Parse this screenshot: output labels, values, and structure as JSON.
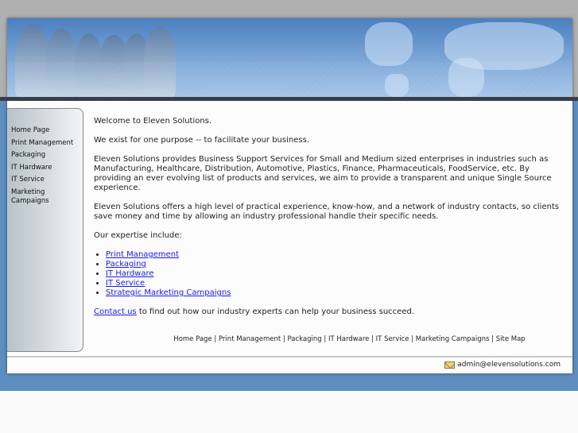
{
  "sidebar": {
    "items": [
      "Home Page",
      "Print Management",
      "Packaging",
      "IT Hardware",
      "IT Service",
      "Marketing Campaigns"
    ]
  },
  "main": {
    "welcome": "Welcome to Eleven Solutions.",
    "purpose": "We exist for one purpose -- to facilitate your business.",
    "para1": "Eleven Solutions provides Business Support Services for Small and Medium sized enterprises in industries such as Manufacturing, Healthcare, Distribution, Automotive, Plastics, Finance, Pharmaceuticals, FoodService, etc. By providing an ever evolving list of products and services, we aim to provide a transparent and unique Single Source experience.",
    "para2": "Eleven Solutions offers a high level of practical experience, know-how, and a network of industry contacts, so clients save money and time by allowing an industry professional handle their specific needs.",
    "expertise_intro": "Our expertise include:",
    "expertise": [
      "Print Management",
      "Packaging",
      "IT Hardware",
      "IT Service",
      "Strategic Marketing Campaigns"
    ],
    "contact_link": "Contact us",
    "contact_rest": " to find out how our industry experts can help your business succeed."
  },
  "footer_links": [
    "Home Page",
    "Print Management",
    "Packaging",
    "IT Hardware",
    "IT Service",
    "Marketing Campaigns",
    "Site Map"
  ],
  "footer": {
    "email": "admin@elevensolutions.com"
  }
}
